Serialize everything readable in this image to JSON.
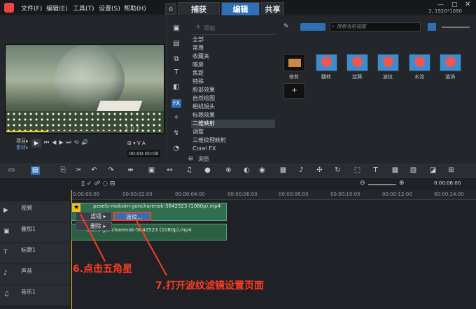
{
  "menu": [
    "文件(F)",
    "编辑(E)",
    "工具(T)",
    "设置(S)",
    "帮助(H)"
  ],
  "tabs": [
    {
      "label": "捕获"
    },
    {
      "label": "编辑"
    },
    {
      "label": "共享"
    }
  ],
  "resolution": "3, 1920*1080",
  "preview": {
    "mode_project": "项目▸",
    "mode_clip": "素材▸",
    "timecode": "00:00:00:00"
  },
  "library": {
    "add_label": "添加",
    "search_placeholder": "搜索当前视图",
    "categories": [
      "全部",
      "常用",
      "收藏夹",
      "暗房",
      "焦距",
      "特殊",
      "脸部效果",
      "自然绘图",
      "相机镜头",
      "标题效果",
      "二维映射",
      "调整",
      "三维纹理映射",
      "Corel FX"
    ],
    "selected_category": "二维映射",
    "browse_label": "浏览",
    "thumbs": [
      "修剪",
      "翻转",
      "涟漪",
      "波纹",
      "水流",
      "漩涡"
    ]
  },
  "timeline": {
    "timecode": "0:00:06:00",
    "ruler": [
      "0:00:00:00",
      "00:00:02:00",
      "00:00:04:00",
      "00:00:06:00",
      "00:00:08:00",
      "00:00:10:00",
      "00:00:12:00",
      "00:00:14:00"
    ],
    "tracks": [
      {
        "name": "视频"
      },
      {
        "name": "叠加1"
      },
      {
        "name": "标题1"
      },
      {
        "name": "声音"
      },
      {
        "name": "音乐1"
      }
    ],
    "clip1": "pexels-maksim-goncharenok-5642523 (1080p).mp4",
    "clip2": "aksim-goncharenok-5642523 (1080p).mp4",
    "ctx": {
      "filter": "滤镜",
      "delete": "删除",
      "sub_item": "波纹..."
    }
  },
  "annotations": {
    "step6": "6.点击五角星",
    "step7": "7.打开波纹滤镜设置页面"
  },
  "colors": {
    "accent": "#2f6fb5",
    "annotation": "#ff3b1f",
    "clip": "#2f6f4f"
  }
}
